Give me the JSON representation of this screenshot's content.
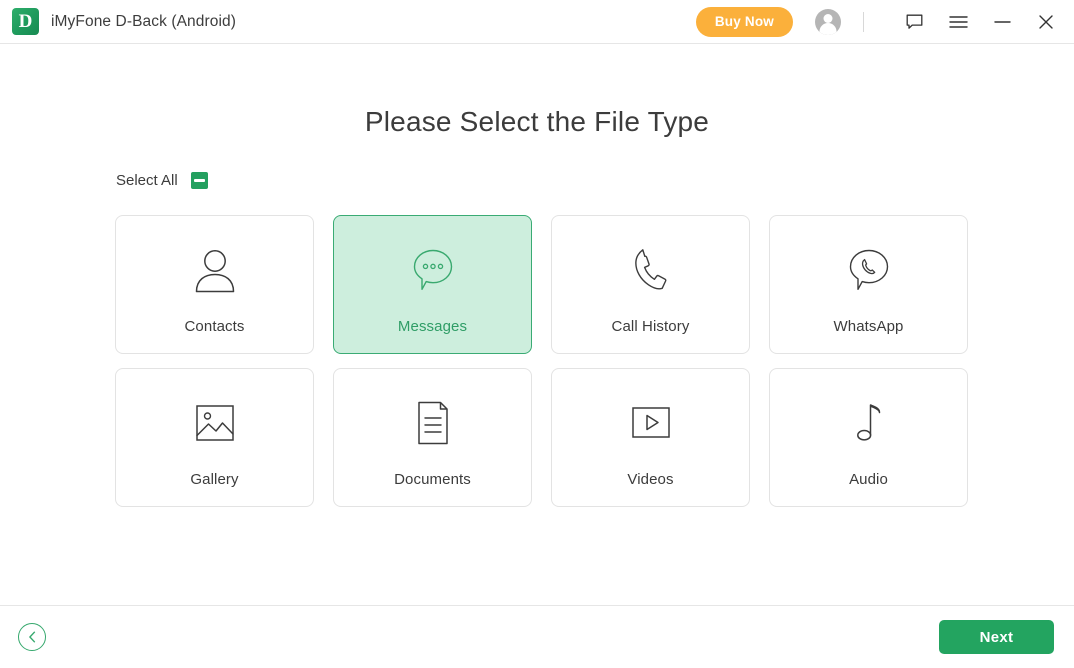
{
  "titlebar": {
    "logo_letter": "D",
    "app_title": "iMyFone D-Back (Android)",
    "buy_now_label": "Buy Now",
    "icons": {
      "avatar": "user-avatar-icon",
      "feedback": "chat-bubble-icon",
      "menu": "hamburger-menu-icon",
      "minimize": "minimize-icon",
      "close": "close-icon"
    },
    "colors": {
      "buy_now_bg": "#fbb03b",
      "logo_bg": "#23a05f"
    }
  },
  "main": {
    "page_title": "Please Select the File Type",
    "select_all_label": "Select All",
    "select_all_state": "indeterminate",
    "file_types": [
      {
        "label": "Contacts",
        "icon": "contact-person-icon",
        "selected": false
      },
      {
        "label": "Messages",
        "icon": "message-bubble-icon",
        "selected": true
      },
      {
        "label": "Call History",
        "icon": "phone-handset-icon",
        "selected": false
      },
      {
        "label": "WhatsApp",
        "icon": "whatsapp-icon",
        "selected": false
      },
      {
        "label": "Gallery",
        "icon": "image-picture-icon",
        "selected": false
      },
      {
        "label": "Documents",
        "icon": "document-page-icon",
        "selected": false
      },
      {
        "label": "Videos",
        "icon": "video-play-icon",
        "selected": false
      },
      {
        "label": "Audio",
        "icon": "music-note-icon",
        "selected": false
      }
    ],
    "colors": {
      "selected_fill": "#cdeedd",
      "selected_border": "#3aab74",
      "selected_text": "#2f9d66",
      "card_border": "#e3e3e3"
    }
  },
  "footer": {
    "back_icon": "chevron-left-icon",
    "next_label": "Next",
    "colors": {
      "next_bg": "#23a460",
      "back_border": "#37a96e"
    }
  }
}
